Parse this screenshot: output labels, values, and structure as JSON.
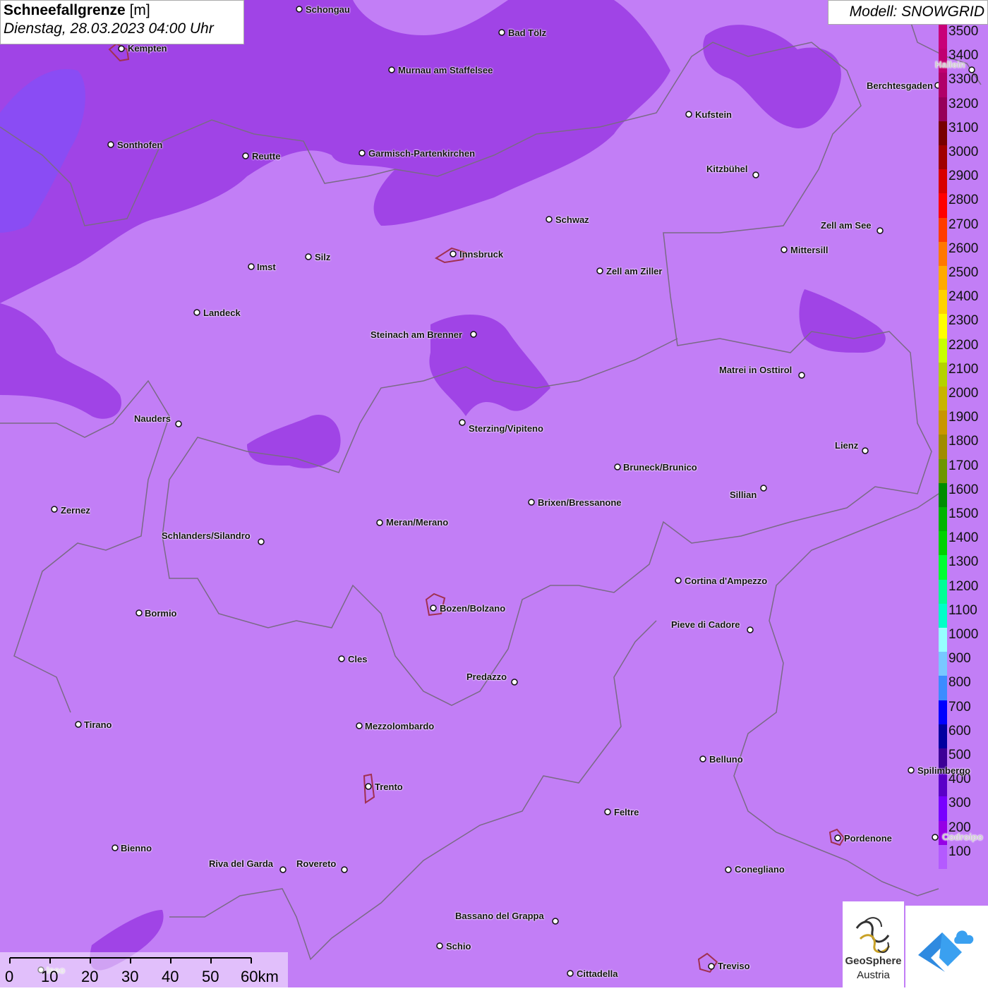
{
  "header": {
    "title_bold": "Schneefallgrenze",
    "title_unit": "[m]",
    "datetime": "Dienstag, 28.03.2023 04:00 Uhr",
    "model": "Modell: SNOWGRID"
  },
  "legend": {
    "labels": [
      "3500",
      "3400",
      "3300",
      "3200",
      "3100",
      "3000",
      "2900",
      "2800",
      "2700",
      "2600",
      "2500",
      "2400",
      "2300",
      "2200",
      "2100",
      "2000",
      "1900",
      "1800",
      "1700",
      "1600",
      "1500",
      "1400",
      "1300",
      "1200",
      "1100",
      "1000",
      "900",
      "800",
      "700",
      "600",
      "500",
      "400",
      "300",
      "200",
      "100"
    ],
    "colors": [
      "#c80078",
      "#c00070",
      "#b00068",
      "#96005a",
      "#780000",
      "#a00000",
      "#d80000",
      "#ff0000",
      "#ff3c00",
      "#ff7800",
      "#ffaa00",
      "#ffd200",
      "#ffff00",
      "#c8ff00",
      "#b4d200",
      "#c8b400",
      "#c89600",
      "#a08c00",
      "#6e9600",
      "#008c00",
      "#00b400",
      "#00d200",
      "#00ff32",
      "#00ff96",
      "#00ffc8",
      "#96ffff",
      "#78c8ff",
      "#3c8cff",
      "#0000ff",
      "#0000a0",
      "#3c0096",
      "#5a00c8",
      "#7800ff",
      "#9600e6",
      "#b45aff"
    ]
  },
  "colors": {
    "background": "#c27ef6",
    "dark_band": "#a044e6",
    "deep_west": "#8a4cf4",
    "border_line": "#7a6a86",
    "city_outline": "#a03050"
  },
  "cities": [
    {
      "name": "Schongau"
    },
    {
      "name": "Bad Tölz"
    },
    {
      "name": "Kempten"
    },
    {
      "name": "Murnau am Staffelsee"
    },
    {
      "name": "Hallein"
    },
    {
      "name": "Berchtesgaden"
    },
    {
      "name": "Kufstein"
    },
    {
      "name": "Sonthofen"
    },
    {
      "name": "Reutte"
    },
    {
      "name": "Garmisch-Partenkirchen"
    },
    {
      "name": "Kitzbühel"
    },
    {
      "name": "Schwaz"
    },
    {
      "name": "Zell am See"
    },
    {
      "name": "Mittersill"
    },
    {
      "name": "Innsbruck"
    },
    {
      "name": "Silz"
    },
    {
      "name": "Imst"
    },
    {
      "name": "Zell am Ziller"
    },
    {
      "name": "Landeck"
    },
    {
      "name": "Steinach am Brenner"
    },
    {
      "name": "Matrei in Osttirol"
    },
    {
      "name": "Nauders"
    },
    {
      "name": "Sterzing/Vipiteno"
    },
    {
      "name": "Lienz"
    },
    {
      "name": "Bruneck/Brunico"
    },
    {
      "name": "Sillian"
    },
    {
      "name": "Brixen/Bressanone"
    },
    {
      "name": "Zernez"
    },
    {
      "name": "Meran/Merano"
    },
    {
      "name": "Schlanders/Silandro"
    },
    {
      "name": "Cortina d'Ampezzo"
    },
    {
      "name": "Bozen/Bolzano"
    },
    {
      "name": "Bormio"
    },
    {
      "name": "Pieve di Cadore"
    },
    {
      "name": "Cles"
    },
    {
      "name": "Predazzo"
    },
    {
      "name": "Tirano"
    },
    {
      "name": "Mezzolombardo"
    },
    {
      "name": "Belluno"
    },
    {
      "name": "Spilimbergo"
    },
    {
      "name": "Trento"
    },
    {
      "name": "Feltre"
    },
    {
      "name": "Pordenone"
    },
    {
      "name": "Codroipo"
    },
    {
      "name": "Bienno"
    },
    {
      "name": "Riva del Garda"
    },
    {
      "name": "Rovereto"
    },
    {
      "name": "Conegliano"
    },
    {
      "name": "Bassano del Grappa"
    },
    {
      "name": "Schio"
    },
    {
      "name": "Iseo"
    },
    {
      "name": "Treviso"
    },
    {
      "name": "Cittadella"
    }
  ],
  "scale": {
    "labels": [
      "0",
      "10",
      "20",
      "30",
      "40",
      "50",
      "60km"
    ]
  },
  "logos": {
    "geosphere_line1": "GeoSphere",
    "geosphere_line2": "Austria"
  }
}
